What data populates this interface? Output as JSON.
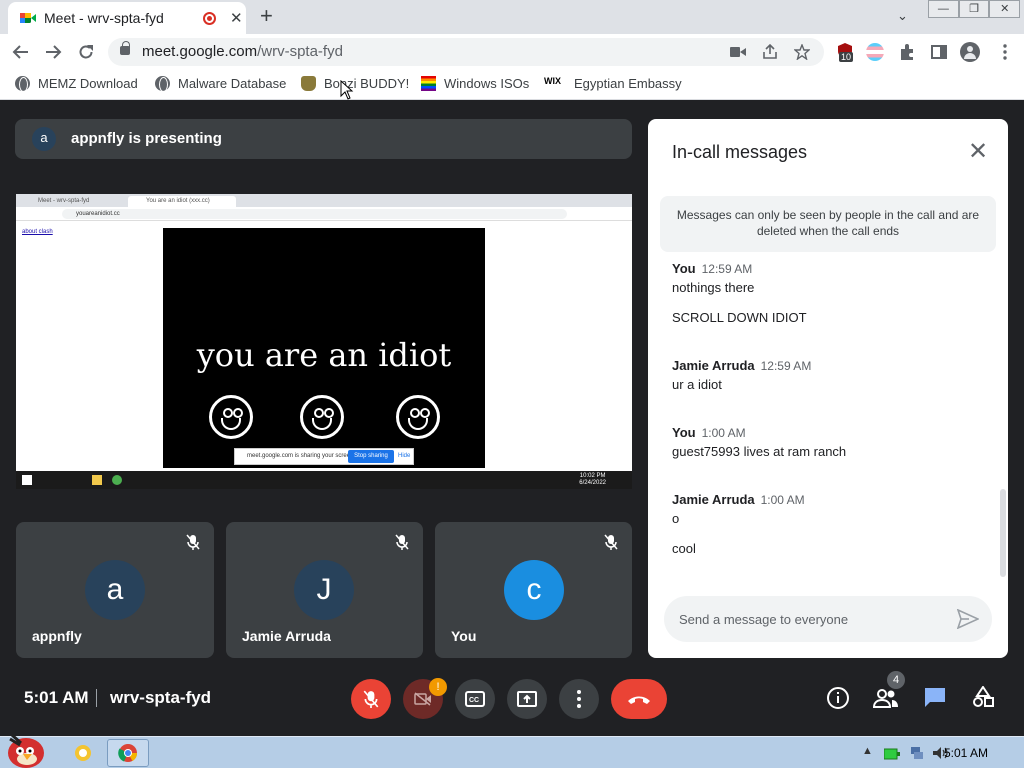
{
  "browser": {
    "tab_title": "Meet - wrv-spta-fyd",
    "tab_close": "✕",
    "new_tab": "+",
    "tab_search": "⌄",
    "window_buttons": [
      "—",
      "❐",
      "✕"
    ],
    "url_host": "meet.google.com",
    "url_path": "/wrv-spta-fyd",
    "extension_badge": "10",
    "bookmarks": [
      {
        "label": "MEMZ Download",
        "icon": "globe-icon"
      },
      {
        "label": "Malware Database",
        "icon": "globe-icon"
      },
      {
        "label": "Bonzi BUDDY!",
        "icon": "bonzi-icon"
      },
      {
        "label": "Windows ISOs",
        "icon": "rainbow-flag-icon"
      },
      {
        "label": "Egyptian Embassy",
        "icon": "wix-icon"
      }
    ],
    "wix_text": "WIX"
  },
  "meet": {
    "presenting": {
      "avatar": "a",
      "text": "appnfly is presenting"
    },
    "shared_screen": {
      "tab1": "Meet - wrv-spta-fyd",
      "tab2": "You are an idiot (xxx.cc)",
      "url": "youareanidiot.cc",
      "links": "about  clash",
      "headline": "you are an idiot",
      "share_notice": "meet.google.com is sharing your screen.",
      "stop_sharing": "Stop sharing",
      "hide": "Hide",
      "clock_time": "10:02 PM",
      "clock_date": "6/24/2022"
    },
    "participants": [
      {
        "name": "appnfly",
        "initial": "a",
        "color": "#28425b"
      },
      {
        "name": "Jamie Arruda",
        "initial": "J",
        "color": "#28425b"
      },
      {
        "name": "You",
        "initial": "c",
        "color": "#1a8ee0"
      }
    ],
    "time": "5:01 AM",
    "meeting_code": "wrv-spta-fyd",
    "video_badge": "!",
    "people_count": "4"
  },
  "chat": {
    "title": "In-call messages",
    "close": "✕",
    "notice": "Messages can only be seen by people in the call and are deleted when the call ends",
    "messages": [
      {
        "sender": "You",
        "time": "12:59 AM",
        "lines": [
          "nothings there",
          "SCROLL DOWN IDIOT"
        ]
      },
      {
        "sender": "Jamie Arruda",
        "time": "12:59 AM",
        "lines": [
          "ur a idiot"
        ]
      },
      {
        "sender": "You",
        "time": "1:00 AM",
        "lines": [
          "guest75993 lives at ram ranch"
        ]
      },
      {
        "sender": "Jamie Arruda",
        "time": "1:00 AM",
        "lines": [
          "o",
          "cool"
        ]
      }
    ],
    "input_placeholder": "Send a message to everyone"
  },
  "taskbar": {
    "clock": "5:01 AM",
    "tray_arrow": "▲"
  }
}
